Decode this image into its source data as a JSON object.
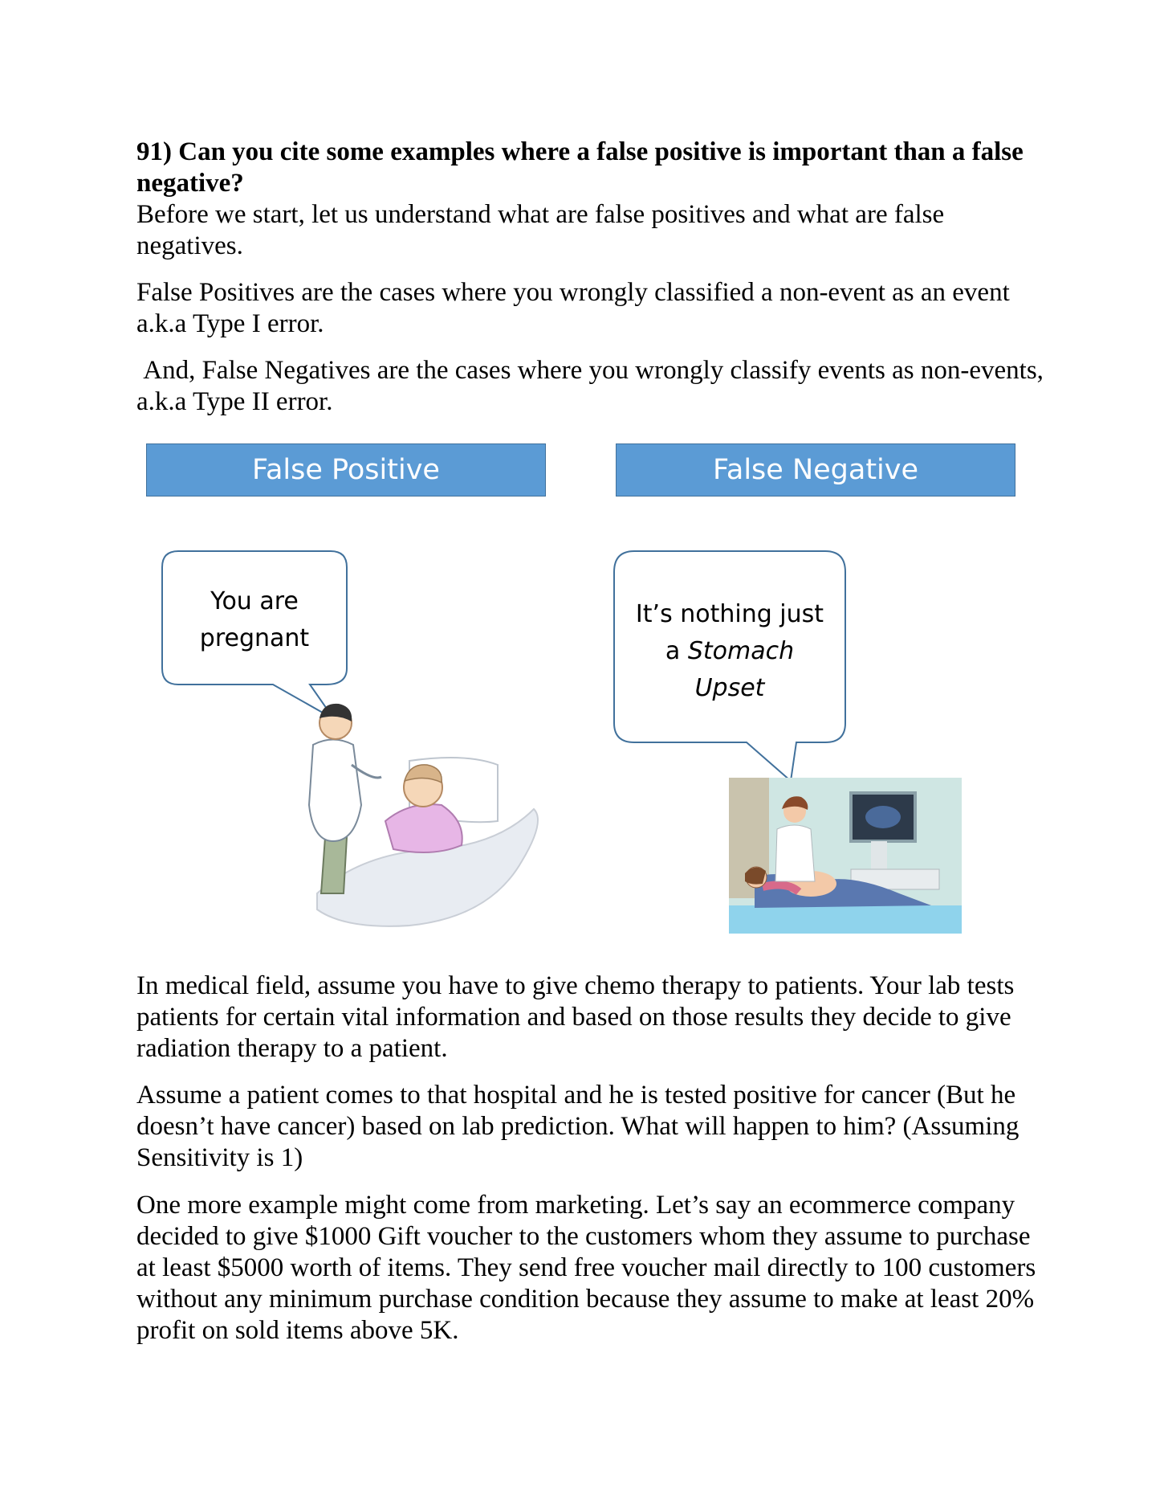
{
  "heading": "91) Can you cite some examples where a false positive is important than a false negative?",
  "intro": "Before we start, let us understand what are false positives and what are false negatives.",
  "false_positive_def": "False Positives are the cases where you wrongly classified a non-event as an event a.k.a Type I error.",
  "false_negative_def": " And, False Negatives are the cases where you wrongly classify events as non-events, a.k.a Type II error.",
  "figure": {
    "left_banner": "False Positive",
    "right_banner": "False Negative",
    "left_bubble_line1": "You are",
    "left_bubble_line2": "pregnant",
    "right_bubble_line1": "It’s nothing just",
    "right_bubble_line2_prefix": "a ",
    "right_bubble_line2_italic": "Stomach",
    "right_bubble_line3_italic": "Upset"
  },
  "paragraph_medical": "In medical field, assume you have to give chemo therapy to patients. Your lab tests patients for certain vital information and based on those results they decide to give radiation therapy to a patient.",
  "paragraph_patient": "Assume a patient comes to that hospital and he is tested positive for cancer (But he doesn’t have cancer) based on lab prediction. What will happen to him? (Assuming Sensitivity is 1)",
  "paragraph_marketing": "One more example might come from marketing. Let’s say an ecommerce company decided to give $1000 Gift voucher to the customers whom they assume to purchase at least $5000 worth of items. They send free voucher mail directly to 100 customers without any minimum purchase condition because they assume to make at least 20% profit on sold items above 5K."
}
